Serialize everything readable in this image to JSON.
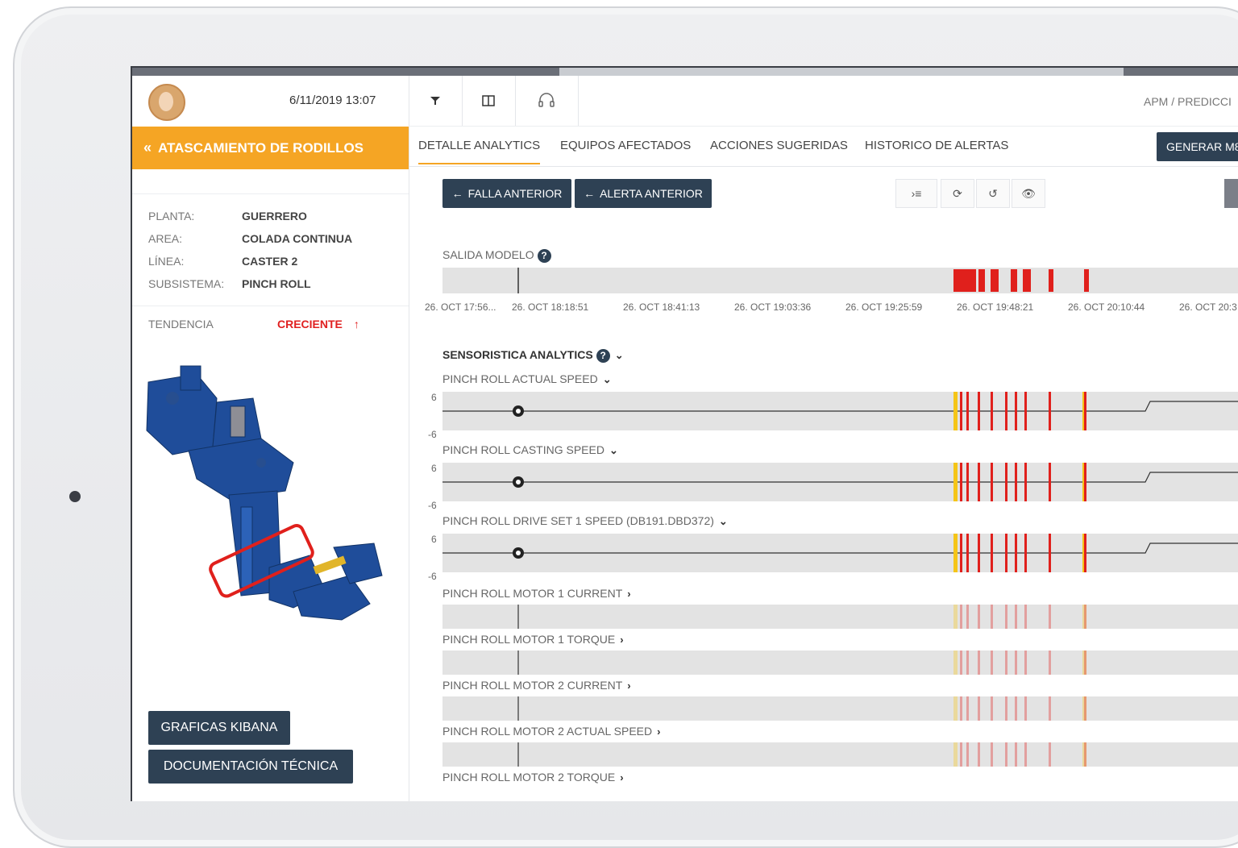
{
  "header": {
    "datetime": "6/11/2019 13:07",
    "breadcrumb": "APM / PREDICCI",
    "toolbar_icons": [
      "filter-icon",
      "columns-icon",
      "headset-icon"
    ]
  },
  "sidebar": {
    "title": "ATASCAMIENTO DE RODILLOS",
    "back_icon": "double-chevron-left-icon",
    "info": [
      {
        "key": "PLANTA:",
        "value": "GUERRERO"
      },
      {
        "key": "AREA:",
        "value": "COLADA CONTINUA"
      },
      {
        "key": "LÍNEA:",
        "value": "CASTER 2"
      },
      {
        "key": "SUBSISTEMA:",
        "value": "PINCH ROLL"
      }
    ],
    "trend_label": "TENDENCIA",
    "trend_value": "CRECIENTE",
    "trend_icon": "arrow-up-icon",
    "buttons": [
      "GRAFICAS KIBANA",
      "DOCUMENTACIÓN TÉCNICA"
    ]
  },
  "tabs": [
    "DETALLE ANALYTICS",
    "EQUIPOS AFECTADOS",
    "ACCIONES SUGERIDAS",
    "HISTORICO DE ALERTAS"
  ],
  "generate_button": "GENERAR M8",
  "nav": {
    "prev_failure": "FALLA ANTERIOR",
    "prev_alert": "ALERTA ANTERIOR",
    "icons": [
      "list-expand-icon",
      "refresh-icon",
      "undo-icon",
      "eye-icon"
    ]
  },
  "model_output": {
    "label": "SALIDA MODELO",
    "ticks": [
      "26. OCT 17:56...",
      "26. OCT 18:18:51",
      "26. OCT 18:41:13",
      "26. OCT 19:03:36",
      "26. OCT 19:25:59",
      "26. OCT 19:48:21",
      "26. OCT 20:10:44",
      "26. OCT 20:3"
    ]
  },
  "sensor_section": {
    "label": "SENSORISTICA ANALYTICS",
    "expanded": [
      {
        "label": "PINCH ROLL ACTUAL SPEED",
        "ymax": "6",
        "ymin": "-6"
      },
      {
        "label": "PINCH ROLL CASTING SPEED",
        "ymax": "6",
        "ymin": "-6"
      },
      {
        "label": "PINCH ROLL DRIVE SET 1 SPEED (DB191.DBD372)",
        "ymax": "6",
        "ymin": "-6"
      }
    ],
    "collapsed": [
      "PINCH ROLL MOTOR 1 CURRENT",
      "PINCH ROLL MOTOR 1 TORQUE",
      "PINCH ROLL MOTOR 2 CURRENT",
      "PINCH ROLL MOTOR 2 ACTUAL SPEED",
      "PINCH ROLL MOTOR 2 TORQUE"
    ]
  },
  "colors": {
    "accent": "#f5a524",
    "dark": "#2e4154",
    "alert_red": "#e0201c",
    "alert_yellow": "#f5c518"
  }
}
